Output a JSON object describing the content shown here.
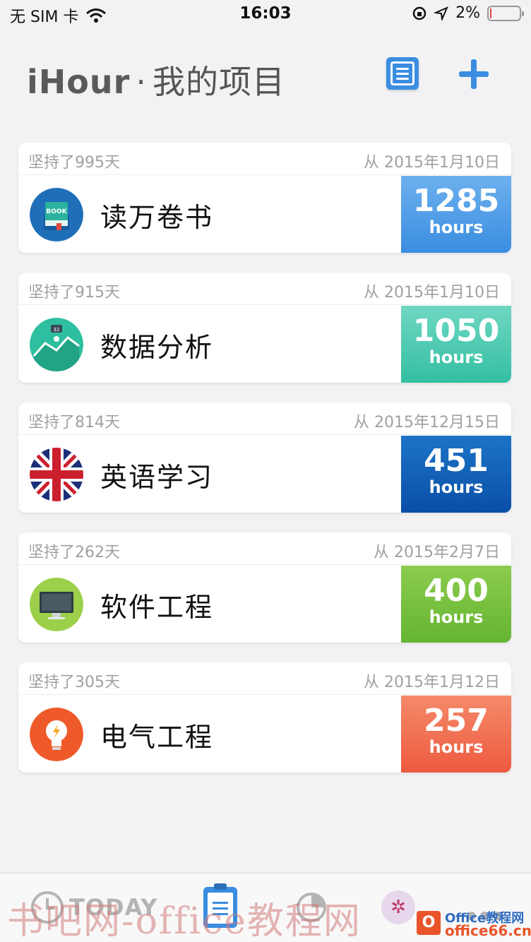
{
  "status_bar": {
    "carrier": "无 SIM 卡",
    "time": "16:03",
    "battery_percent": "2%",
    "battery_level": 0.02
  },
  "header": {
    "app_name": "iHour",
    "separator": "·",
    "subtitle": "我的项目"
  },
  "projects": [
    {
      "days": "坚持了995天",
      "since": "从 2015年1月10日",
      "name": "读万卷书",
      "hours": "1285",
      "unit": "hours",
      "color_top": "#6db0ee",
      "color_bottom": "#3a8de0",
      "icon": "book-icon",
      "icon_text": "BOOK"
    },
    {
      "days": "坚持了915天",
      "since": "从 2015年1月10日",
      "name": "数据分析",
      "hours": "1050",
      "unit": "hours",
      "color_top": "#6fd7c2",
      "color_bottom": "#34bfa3",
      "icon": "chart-icon",
      "icon_text": "32"
    },
    {
      "days": "坚持了814天",
      "since": "从 2015年12月15日",
      "name": "英语学习",
      "hours": "451",
      "unit": "hours",
      "color_top": "#1c74c6",
      "color_bottom": "#0a4fa8",
      "icon": "uk-flag-icon"
    },
    {
      "days": "坚持了262天",
      "since": "从 2015年2月7日",
      "name": "软件工程",
      "hours": "400",
      "unit": "hours",
      "color_top": "#8ccb4e",
      "color_bottom": "#64b532",
      "icon": "computer-icon"
    },
    {
      "days": "坚持了305天",
      "since": "从 2015年1月12日",
      "name": "电气工程",
      "hours": "257",
      "unit": "hours",
      "color_top": "#f48a6a",
      "color_bottom": "#ee5a3f",
      "icon": "lightbulb-icon"
    }
  ],
  "tab_bar": {
    "today_label": "TODAY"
  },
  "watermark": {
    "left_text": "书吧网-office教程网",
    "logo_letter": "O",
    "right_line1": "Office教程网",
    "right_line2": "office66.cn"
  }
}
